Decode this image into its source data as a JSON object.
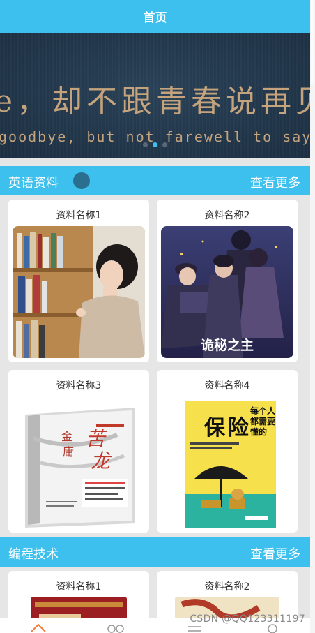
{
  "header": {
    "title": "首页"
  },
  "banner": {
    "line1": "e，却不跟青春说再见",
    "line2": "goodbye, but not farewell to say go",
    "active_slide": 2,
    "slide_count": 3
  },
  "sections": [
    {
      "title": "英语资料",
      "more_label": "查看更多",
      "items": [
        {
          "title": "资料名称1",
          "image": "woman-reading-bookshelf"
        },
        {
          "title": "资料名称2",
          "image": "anime-cover",
          "cover_text": "诡秘之主"
        },
        {
          "title": "资料名称3",
          "image": "book-cover-jin-yong",
          "cover_text": "苦龙游塔"
        },
        {
          "title": "资料名称4",
          "image": "book-cover-insurance",
          "cover_text": "每个人都需要懂的保险"
        }
      ]
    },
    {
      "title": "编程技术",
      "more_label": "查看更多",
      "items": [
        {
          "title": "资料名称1",
          "image": "red-book-cover"
        },
        {
          "title": "资料名称2",
          "image": "beige-book-cover"
        }
      ]
    }
  ],
  "tabbar": {
    "items": [
      {
        "icon": "home-icon",
        "active": true
      },
      {
        "icon": "glasses-icon",
        "active": false
      },
      {
        "icon": "list-icon",
        "active": false
      },
      {
        "icon": "user-icon",
        "active": false
      }
    ]
  },
  "watermark": "CSDN @QQ123311197",
  "colors": {
    "accent": "#3ec0ee",
    "background": "#e6e6e6",
    "card": "#ffffff",
    "nav_active": "#f07a3a"
  }
}
